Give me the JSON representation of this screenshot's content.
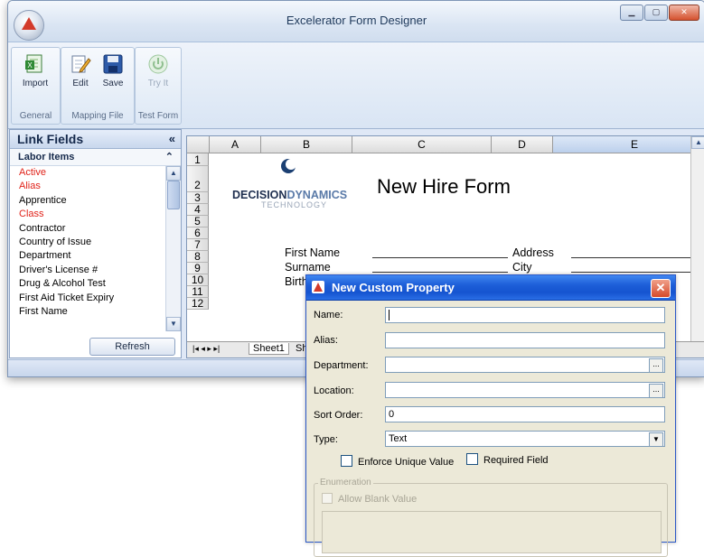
{
  "window": {
    "title": "Excelerator Form Designer",
    "buttons": [
      "▁",
      "▢",
      "✕"
    ]
  },
  "ribbon": {
    "groups": [
      {
        "label": "General",
        "buttons": [
          {
            "label": "Import",
            "icon": "excel-import-icon"
          }
        ]
      },
      {
        "label": "Mapping File",
        "buttons": [
          {
            "label": "Edit",
            "icon": "edit-icon"
          },
          {
            "label": "Save",
            "icon": "save-icon"
          }
        ]
      },
      {
        "label": "Test Form",
        "buttons": [
          {
            "label": "Try It",
            "icon": "power-icon",
            "disabled": true
          }
        ]
      }
    ]
  },
  "sidebar": {
    "title": "Link Fields",
    "collapse": "«",
    "section": "Labor Items",
    "section_toggle": "⌃",
    "items": [
      {
        "label": "Active",
        "red": true
      },
      {
        "label": "Alias",
        "red": true
      },
      {
        "label": "Apprentice",
        "red": false
      },
      {
        "label": "Class",
        "red": true
      },
      {
        "label": "Contractor",
        "red": false
      },
      {
        "label": "Country of Issue",
        "red": false
      },
      {
        "label": "Department",
        "red": false
      },
      {
        "label": "Driver's License #",
        "red": false
      },
      {
        "label": "Drug & Alcohol Test",
        "red": false
      },
      {
        "label": "First Aid Ticket Expiry",
        "red": false
      },
      {
        "label": "First Name",
        "red": false
      }
    ],
    "refresh_label": "Refresh"
  },
  "sheet": {
    "columns": [
      "A",
      "B",
      "C",
      "D",
      "E"
    ],
    "rows": [
      "1",
      "2",
      "3",
      "4",
      "5",
      "6",
      "7",
      "8",
      "9",
      "10",
      "11",
      "12"
    ],
    "logo_main": "DECISION",
    "logo_accent": "DYNAMICS",
    "logo_sub": "TECHNOLOGY",
    "form_title": "New Hire Form",
    "labels": {
      "first_name": "First Name",
      "surname": "Surname",
      "birthdate": "Birthd",
      "address": "Address",
      "city": "City"
    },
    "tab_nav": "|◂ ◂ ▸ ▸|",
    "tabs": [
      "Sheet1",
      "Sh"
    ]
  },
  "dialog": {
    "title": "New Custom Property",
    "close": "✕",
    "fields": {
      "name": {
        "label": "Name:",
        "value": ""
      },
      "alias": {
        "label": "Alias:",
        "value": ""
      },
      "department": {
        "label": "Department:",
        "value": ""
      },
      "location": {
        "label": "Location:",
        "value": ""
      },
      "sort_order": {
        "label": "Sort Order:",
        "value": "0"
      },
      "type": {
        "label": "Type:",
        "value": "Text"
      }
    },
    "ellipsis": "...",
    "dropdown_arrow": "▼",
    "enforce_unique": "Enforce Unique Value",
    "required_field": "Required Field",
    "enumeration_legend": "Enumeration",
    "allow_blank": "Allow Blank Value"
  }
}
